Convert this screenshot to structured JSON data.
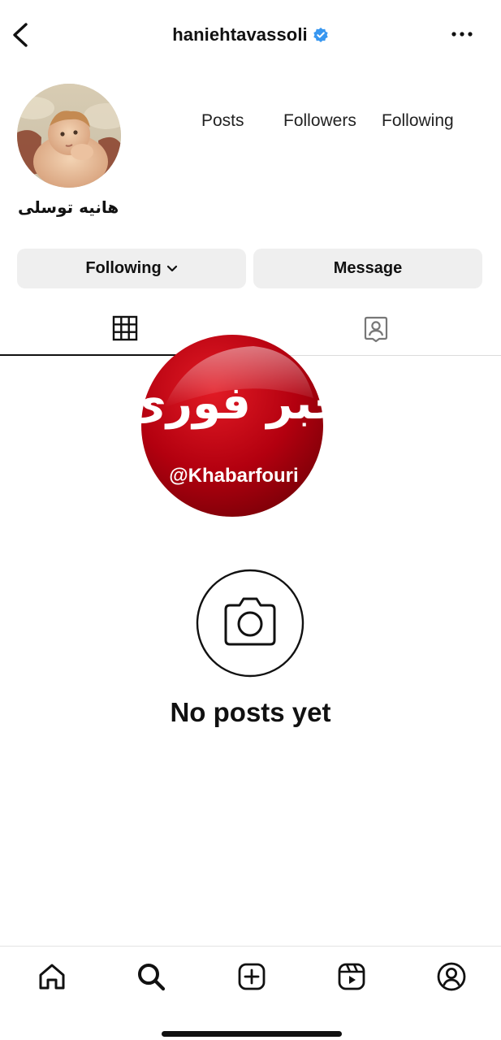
{
  "header": {
    "username": "haniehtavassoli",
    "verified": true,
    "verified_color": "#3897f0",
    "back_icon": "chevron-left-icon",
    "more_icon": "more-horizontal-icon"
  },
  "profile": {
    "full_name": "هانیه توسلی",
    "stats": {
      "posts_label": "Posts",
      "followers_label": "Followers",
      "following_label": "Following"
    }
  },
  "actions": {
    "following_label": "Following",
    "message_label": "Message"
  },
  "tabs": [
    {
      "name": "grid",
      "icon": "grid-icon",
      "active": true
    },
    {
      "name": "tagged",
      "icon": "tagged-person-icon",
      "active": false
    }
  ],
  "watermark": {
    "arabic_text": "خبر فوری",
    "handle": "@Khabarfouri",
    "color": "#b3000f"
  },
  "empty_state": {
    "icon": "camera-icon",
    "text": "No posts yet"
  },
  "bottom_nav": [
    {
      "name": "home",
      "icon": "home-icon"
    },
    {
      "name": "search",
      "icon": "search-icon"
    },
    {
      "name": "create",
      "icon": "plus-square-icon"
    },
    {
      "name": "reels",
      "icon": "reels-icon"
    },
    {
      "name": "profile",
      "icon": "profile-icon"
    }
  ]
}
